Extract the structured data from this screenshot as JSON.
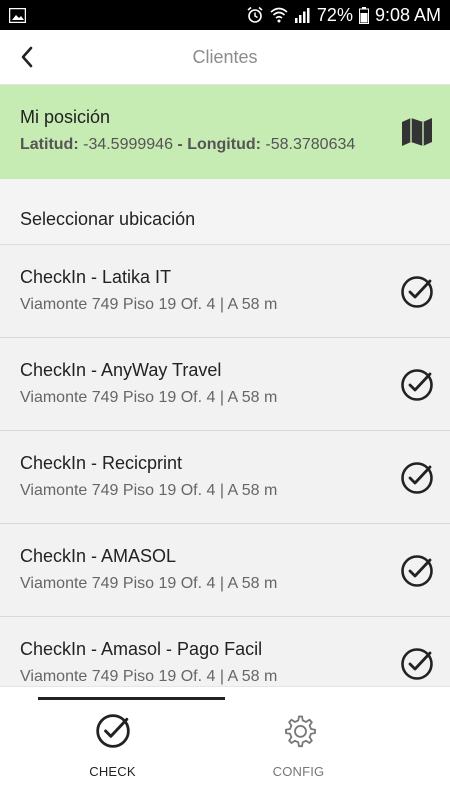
{
  "status_bar": {
    "battery_percent": "72%",
    "time": "9:08 AM"
  },
  "app_bar": {
    "title": "Clientes"
  },
  "my_position": {
    "title": "Mi posición",
    "lat_label": "Latitud:",
    "lat_value": "-34.5999946",
    "separator": "-",
    "lng_label": "Longitud:",
    "lng_value": "-58.3780634"
  },
  "section": {
    "title": "Seleccionar ubicación"
  },
  "locations": [
    {
      "name": "CheckIn - Latika IT",
      "address": "Viamonte 749 Piso 19 Of. 4 | A 58 m"
    },
    {
      "name": "CheckIn - AnyWay Travel",
      "address": "Viamonte 749 Piso 19 Of. 4 | A 58 m"
    },
    {
      "name": "CheckIn - Recicprint",
      "address": "Viamonte 749 Piso 19 Of. 4 | A 58 m"
    },
    {
      "name": "CheckIn - AMASOL",
      "address": "Viamonte 749 Piso 19 Of. 4 | A 58 m"
    },
    {
      "name": "CheckIn - Amasol - Pago Facil",
      "address": "Viamonte 749 Piso 19 Of. 4 | A 58 m"
    }
  ],
  "bottom_nav": {
    "check_label": "CHECK",
    "config_label": "CONFIG"
  },
  "colors": {
    "position_bg": "#c6ebb3",
    "status_bar_bg": "#000000",
    "icon_dark": "#222222"
  },
  "icons": {
    "gallery": "gallery-icon",
    "alarm": "alarm-icon",
    "wifi": "wifi-icon",
    "signal": "signal-icon",
    "battery": "battery-icon",
    "back": "back-arrow-icon",
    "map": "map-icon",
    "check": "check-circle-icon",
    "settings": "gear-icon"
  }
}
